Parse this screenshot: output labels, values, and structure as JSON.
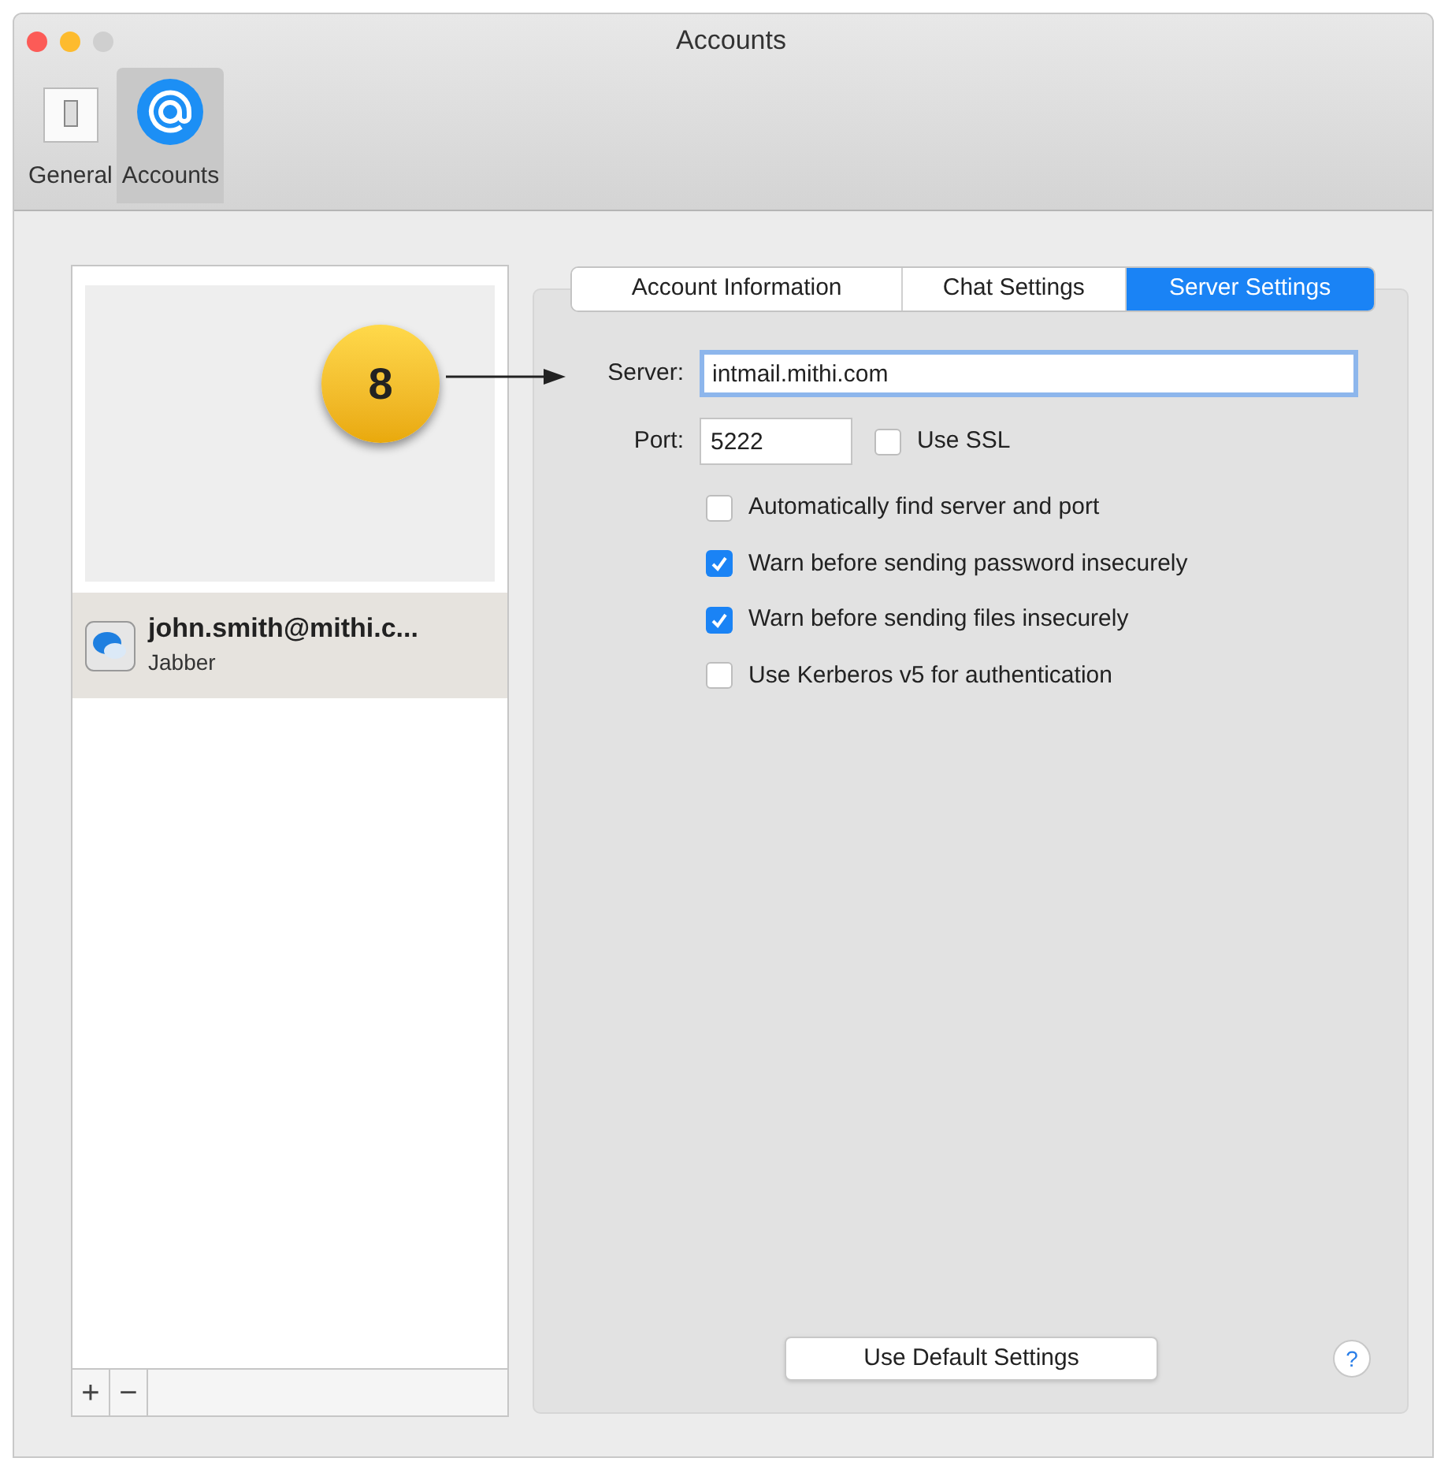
{
  "window": {
    "title": "Accounts"
  },
  "toolbar": [
    {
      "label": "General",
      "kind": "general",
      "selected": false
    },
    {
      "label": "Accounts",
      "kind": "accounts",
      "selected": true
    }
  ],
  "accounts": [
    {
      "name": "john.smith@mithi.c...",
      "type": "Jabber",
      "selected": true
    }
  ],
  "list_buttons": [
    "+",
    "−"
  ],
  "tabs": [
    {
      "label": "Account Information",
      "selected": false
    },
    {
      "label": "Chat Settings",
      "selected": false
    },
    {
      "label": "Server Settings",
      "selected": true
    }
  ],
  "server": {
    "label": "Server:",
    "value": "intmail.mithi.com",
    "focused": true
  },
  "port": {
    "label": "Port:",
    "value": "5222"
  },
  "use_ssl": {
    "label": "Use SSL",
    "checked": false
  },
  "options": [
    {
      "label": "Automatically find server and port",
      "checked": false
    },
    {
      "label": "Warn before sending password insecurely",
      "checked": true
    },
    {
      "label": "Warn before sending files insecurely",
      "checked": true
    },
    {
      "label": "Use Kerberos v5 for authentication",
      "checked": false
    }
  ],
  "default_button": "Use Default Settings",
  "help": "?",
  "callout": {
    "number": "8"
  }
}
